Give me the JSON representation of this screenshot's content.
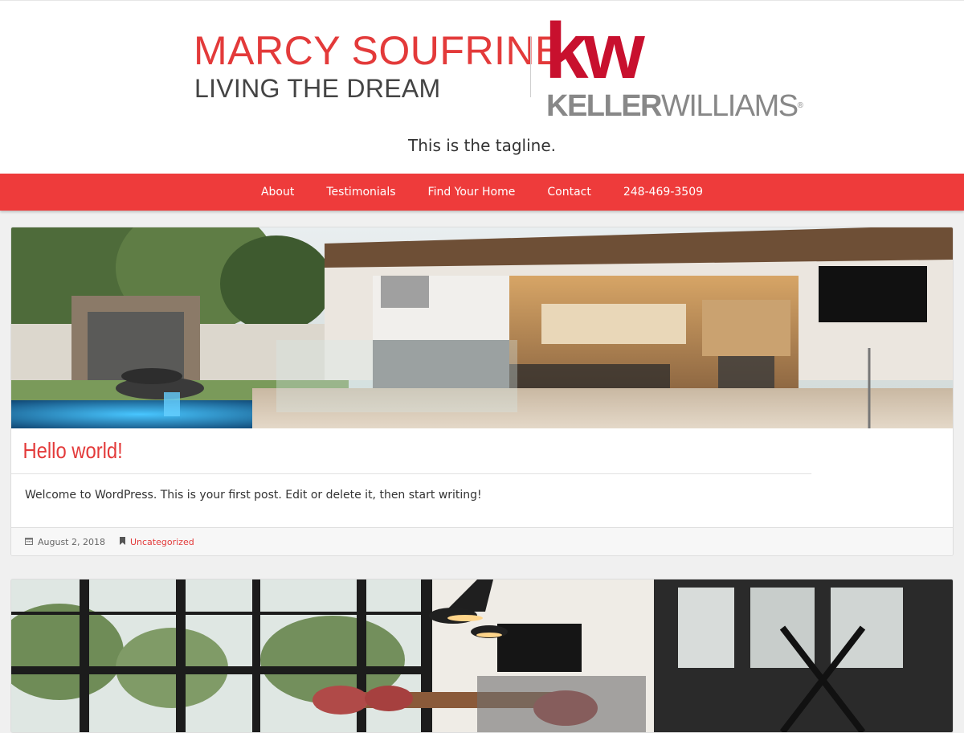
{
  "header": {
    "name": "MARCY SOUFRINE",
    "subtitle": "LIVING THE DREAM",
    "logo_mark": "kw",
    "logo_word_bold": "KELLER",
    "logo_word_light": "WILLIAMS",
    "logo_reg": "®",
    "tagline": "This is the tagline."
  },
  "nav": {
    "items": [
      {
        "label": "About"
      },
      {
        "label": "Testimonials"
      },
      {
        "label": "Find Your Home"
      },
      {
        "label": "Contact"
      },
      {
        "label": "248-469-3509"
      }
    ]
  },
  "posts": [
    {
      "title": "Hello world!",
      "excerpt": "Welcome to WordPress. This is your first post. Edit or delete it, then start writing!",
      "date": "August 2, 2018",
      "category": "Uncategorized"
    }
  ],
  "colors": {
    "accent": "#ee3b3b",
    "kw_red": "#c8102e",
    "kw_gray": "#888888"
  }
}
